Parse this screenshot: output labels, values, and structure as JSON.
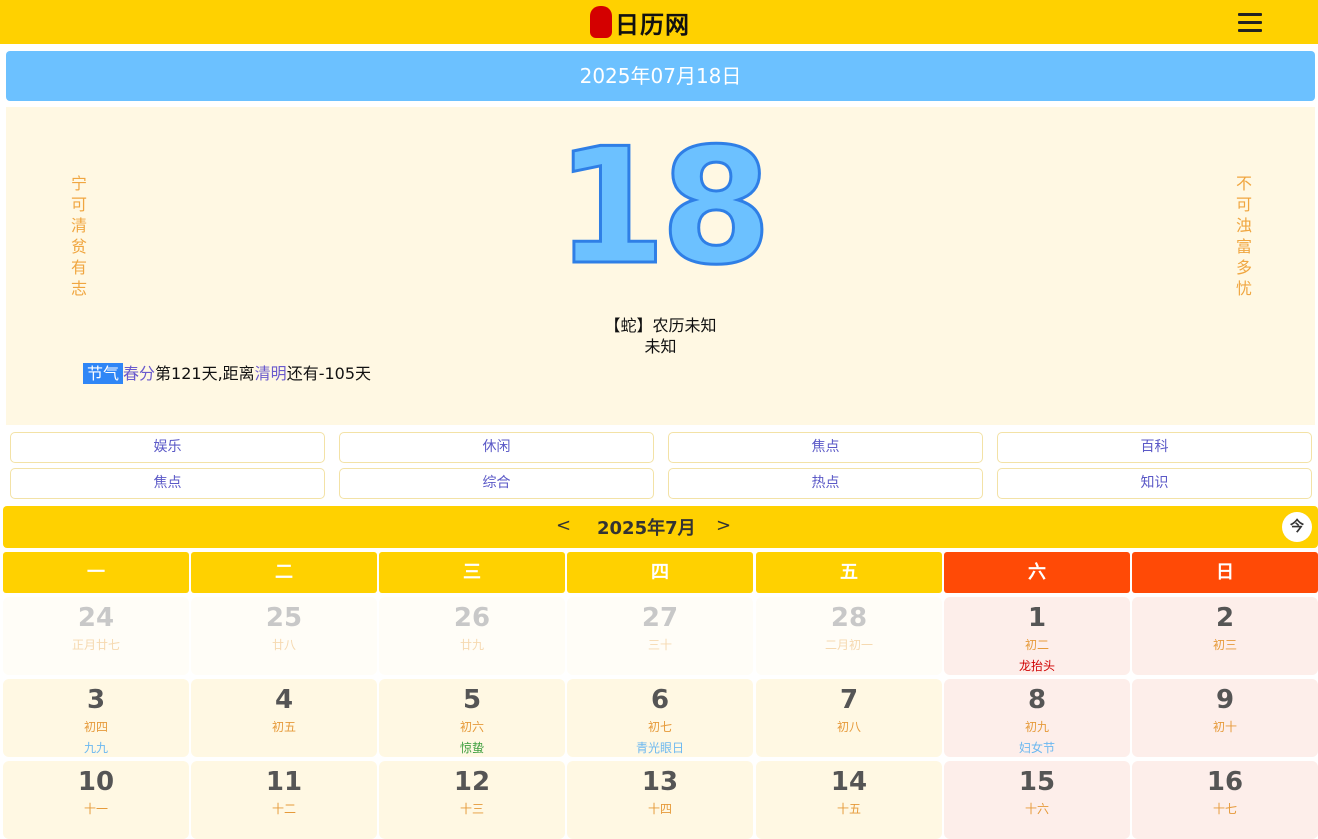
{
  "header": {
    "logo_seal": "日历网",
    "title": "日历网"
  },
  "date_banner": "2025年07月18日",
  "hero": {
    "motto_left": [
      "宁",
      "可",
      "清",
      "贫",
      "有",
      "志"
    ],
    "motto_right": [
      "不",
      "可",
      "浊",
      "富",
      "多",
      "忧"
    ],
    "day": "18",
    "lunar_line1": "【蛇】农历未知",
    "lunar_line2": "未知",
    "solar_term": {
      "tag": "节气",
      "current": "春分",
      "days_text": "第121天,距离",
      "next": "清明",
      "remain_text": "还有-105天"
    }
  },
  "links": [
    "娱乐",
    "休闲",
    "焦点",
    "百科",
    "焦点",
    "综合",
    "热点",
    "知识"
  ],
  "calendar": {
    "prev": "<",
    "month_label": "2025年7月",
    "next": ">",
    "today_button": "今",
    "weekdays": [
      "一",
      "二",
      "三",
      "四",
      "五",
      "六",
      "日"
    ],
    "colors": {
      "weekday": "#ffd100",
      "weekend": "#ff4a06",
      "weekday_cell": "#fff8e3",
      "weekend_cell": "#fdeeea",
      "other_cell": "#fffdf7"
    },
    "days": [
      {
        "d": "24",
        "l": "正月廿七",
        "f": "",
        "other": true
      },
      {
        "d": "25",
        "l": "廿八",
        "f": "",
        "other": true
      },
      {
        "d": "26",
        "l": "廿九",
        "f": "",
        "other": true
      },
      {
        "d": "27",
        "l": "三十",
        "f": "",
        "other": true
      },
      {
        "d": "28",
        "l": "二月初一",
        "f": "",
        "other": true
      },
      {
        "d": "1",
        "l": "初二",
        "f": "龙抬头",
        "fc": "#d00000"
      },
      {
        "d": "2",
        "l": "初三",
        "f": ""
      },
      {
        "d": "3",
        "l": "初四",
        "f": "九九",
        "fc": "#6cb8f0"
      },
      {
        "d": "4",
        "l": "初五",
        "f": ""
      },
      {
        "d": "5",
        "l": "初六",
        "f": "惊蛰",
        "fc": "#3f9f3f"
      },
      {
        "d": "6",
        "l": "初七",
        "f": "青光眼日",
        "fc": "#6cb8f0"
      },
      {
        "d": "7",
        "l": "初八",
        "f": ""
      },
      {
        "d": "8",
        "l": "初九",
        "f": "妇女节",
        "fc": "#6cb8f0"
      },
      {
        "d": "9",
        "l": "初十",
        "f": ""
      },
      {
        "d": "10",
        "l": "十一",
        "f": ""
      },
      {
        "d": "11",
        "l": "十二",
        "f": ""
      },
      {
        "d": "12",
        "l": "十三",
        "f": ""
      },
      {
        "d": "13",
        "l": "十四",
        "f": ""
      },
      {
        "d": "14",
        "l": "十五",
        "f": ""
      },
      {
        "d": "15",
        "l": "十六",
        "f": ""
      },
      {
        "d": "16",
        "l": "十七",
        "f": ""
      }
    ]
  }
}
